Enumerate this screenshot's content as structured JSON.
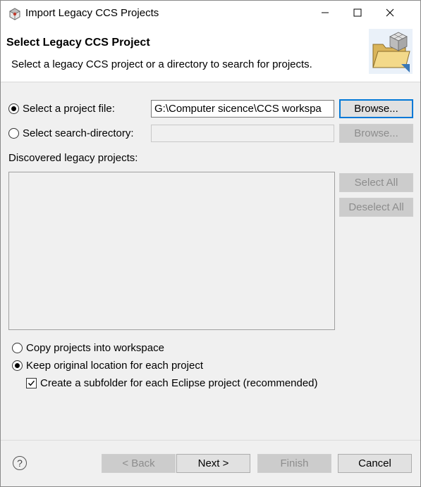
{
  "window": {
    "title": "Import Legacy CCS Projects",
    "icon": "eclipse-ccs-icon",
    "controls": [
      "minimize-icon",
      "maximize-icon",
      "close-icon"
    ]
  },
  "header": {
    "title": "Select Legacy CCS Project",
    "description": "Select a legacy CCS project or a directory to search for projects.",
    "banner_icon": "import-folder-banner-icon"
  },
  "source": {
    "project_file": {
      "label": "Select a project file:",
      "selected": true,
      "value": "G:\\Computer sicence\\CCS workspa",
      "browse_label": "Browse..."
    },
    "search_directory": {
      "label": "Select search-directory:",
      "selected": false,
      "value": "",
      "browse_label": "Browse..."
    }
  },
  "discovered": {
    "label": "Discovered legacy projects:",
    "items": [],
    "select_all_label": "Select All",
    "deselect_all_label": "Deselect All"
  },
  "options": {
    "copy_label": "Copy projects into workspace",
    "copy_selected": false,
    "keep_label": "Keep original location for each project",
    "keep_selected": true,
    "subfolder_label": "Create a subfolder for each Eclipse project (recommended)",
    "subfolder_checked": true
  },
  "footer": {
    "help": "?",
    "back_label": "< Back",
    "next_label": "Next >",
    "finish_label": "Finish",
    "cancel_label": "Cancel"
  },
  "colors": {
    "accent": "#0078d7",
    "dialog_bg": "#f0f0f0",
    "disabled_text": "#8d8d8d"
  }
}
